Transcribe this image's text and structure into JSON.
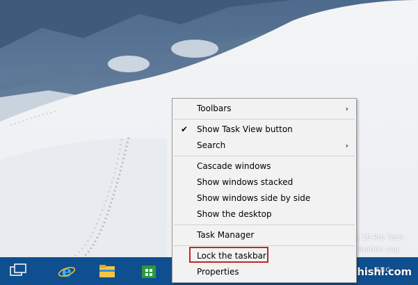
{
  "desktop": {
    "watermark_line1": "ows 10 Pro Tech",
    "watermark_line2": "Evaluation cop",
    "site_mark": "zhishi.com"
  },
  "taskbar": {
    "tray_text": "ENG",
    "icons": [
      "task-view-icon",
      "internet-explorer-icon",
      "file-explorer-icon",
      "store-icon"
    ]
  },
  "context_menu": {
    "toolbars": "Toolbars",
    "show_task_view": "Show Task View button",
    "search": "Search",
    "cascade": "Cascade windows",
    "stacked": "Show windows stacked",
    "side_by_side": "Show windows side by side",
    "show_desktop": "Show the desktop",
    "task_manager": "Task Manager",
    "lock_taskbar": "Lock the taskbar",
    "properties": "Properties",
    "check_mark": "✔",
    "submenu_arrow": "›"
  },
  "colors": {
    "taskbar": "#0f4f8f",
    "menu_background": "#f2f2f2",
    "highlight_border": "#c0252b"
  }
}
